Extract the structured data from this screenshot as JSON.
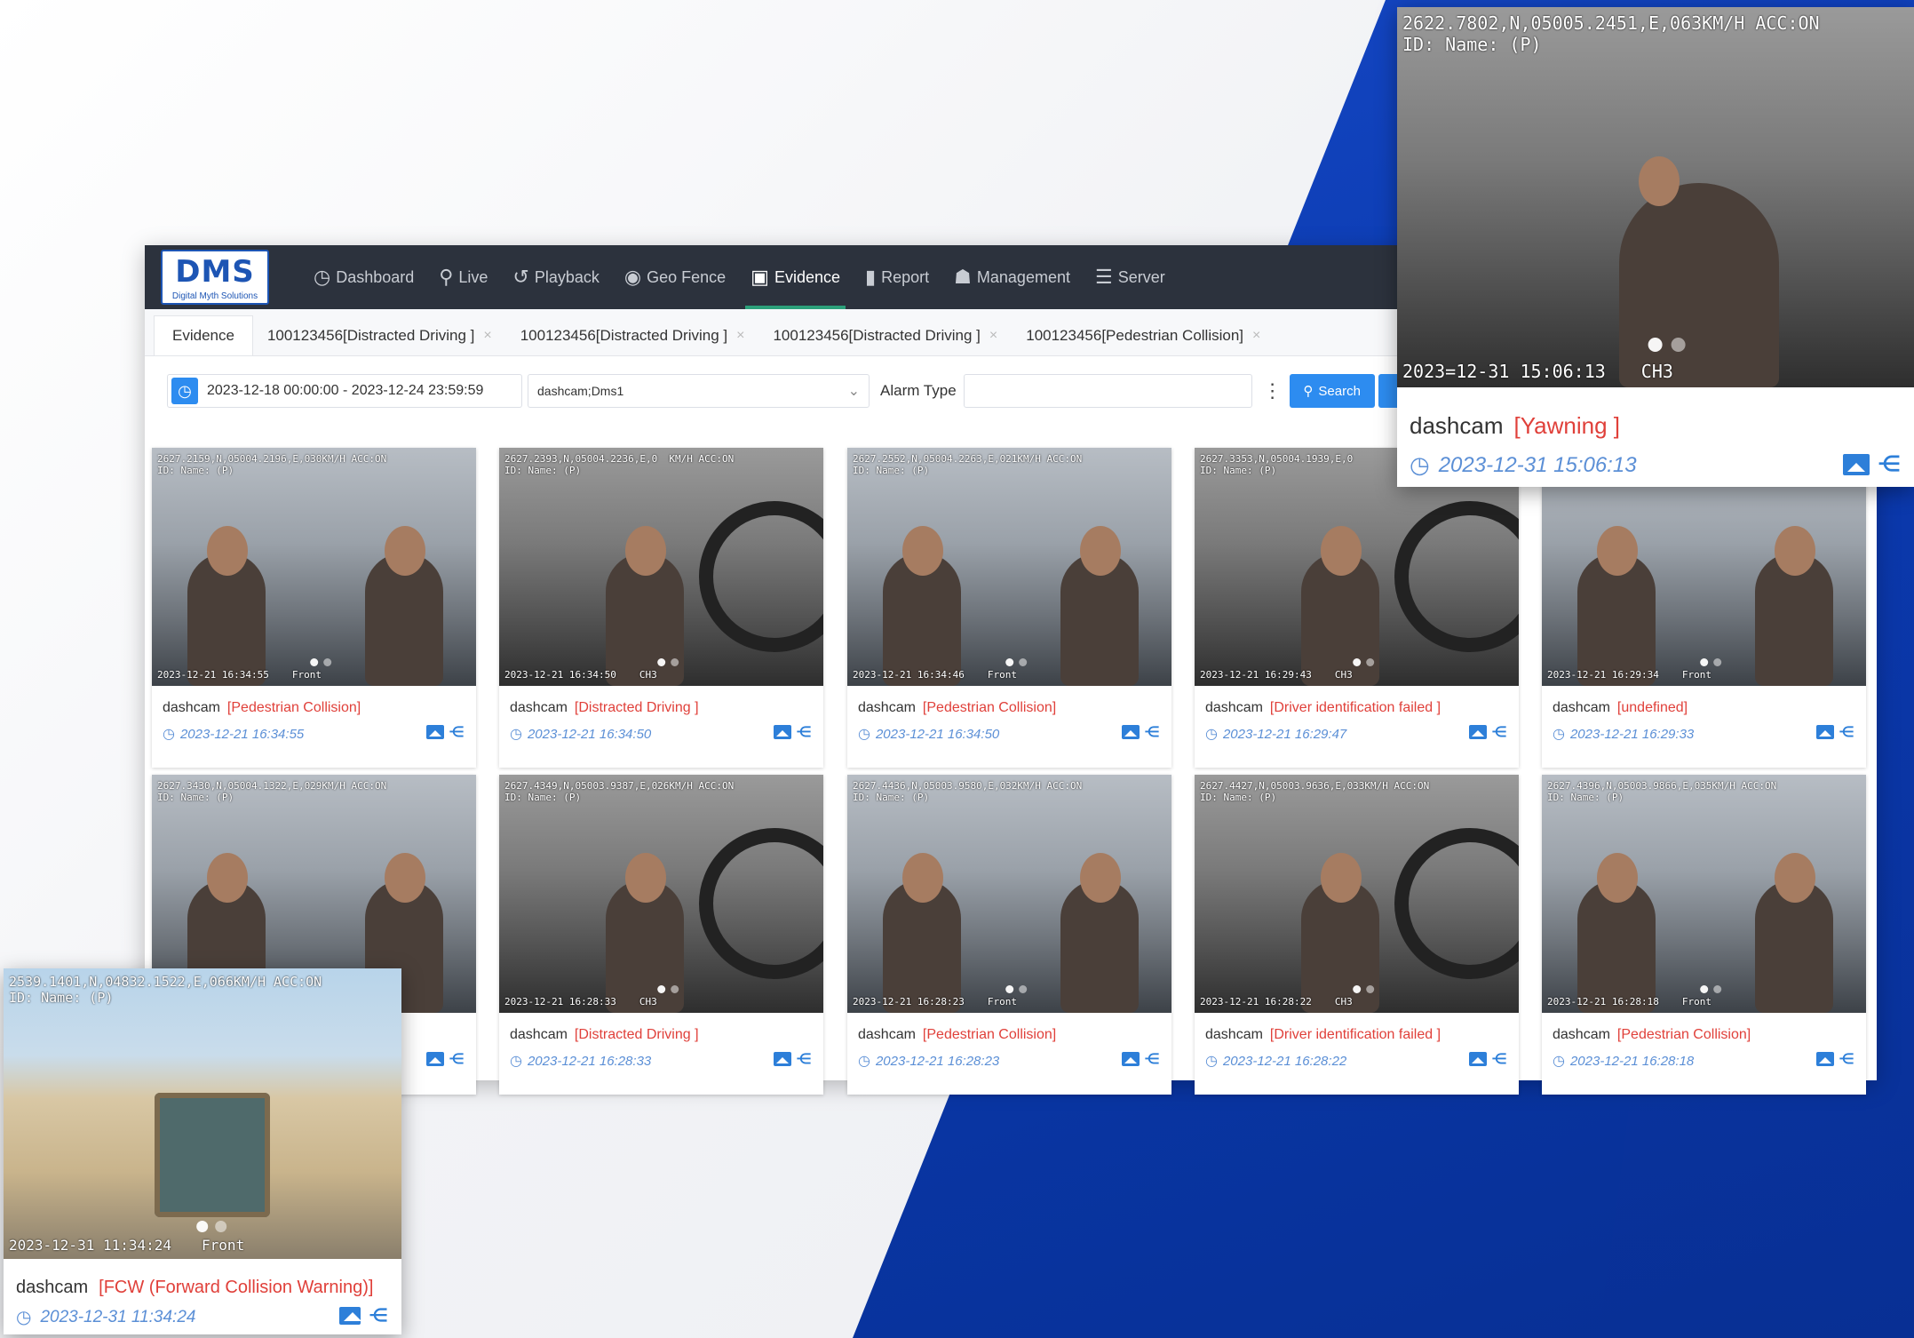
{
  "nav": {
    "logo_text": "DMS",
    "logo_sub": "Digital Myth Solutions",
    "items": [
      {
        "label": "Dashboard",
        "icon": "dashboard-icon",
        "glyph": "◷"
      },
      {
        "label": "Live",
        "icon": "live-icon",
        "glyph": "⚲"
      },
      {
        "label": "Playback",
        "icon": "playback-icon",
        "glyph": "↺"
      },
      {
        "label": "Geo Fence",
        "icon": "geofence-icon",
        "glyph": "◉"
      },
      {
        "label": "Evidence",
        "icon": "evidence-icon",
        "glyph": "▣"
      },
      {
        "label": "Report",
        "icon": "report-icon",
        "glyph": "▮"
      },
      {
        "label": "Management",
        "icon": "management-icon",
        "glyph": "☗"
      },
      {
        "label": "Server",
        "icon": "server-icon",
        "glyph": "☰"
      }
    ],
    "active": "Evidence"
  },
  "tabs": [
    {
      "label": "Evidence",
      "closable": false
    },
    {
      "label": "100123456[Distracted Driving ]",
      "closable": true
    },
    {
      "label": "100123456[Distracted Driving ]",
      "closable": true
    },
    {
      "label": "100123456[Distracted Driving ]",
      "closable": true
    },
    {
      "label": "100123456[Pedestrian Collision]",
      "closable": true
    }
  ],
  "filters": {
    "date_range": "2023-12-18 00:00:00 - 2023-12-24 23:59:59",
    "device": "dashcam;Dms1",
    "alarm_type_label": "Alarm Type",
    "alarm_type_value": "",
    "search_label": "Search"
  },
  "cards": [
    {
      "device": "dashcam",
      "alarm": "[Pedestrian Collision]",
      "time": "2023-12-21 16:34:55",
      "osd": "2627.2159,N,05004.2196,E,030KM/H ACC:ON\nID: Name: (P)",
      "osd_time": "2023-12-21 16:34:55",
      "channel": "Front",
      "mode": "color"
    },
    {
      "device": "dashcam",
      "alarm": "[Distracted Driving ]",
      "time": "2023-12-21 16:34:50",
      "osd": "2627.2393,N,05004.2236,E,0  KM/H ACC:ON\nID: Name: (P)",
      "osd_time": "2023-12-21 16:34:50",
      "channel": "CH3",
      "mode": "night"
    },
    {
      "device": "dashcam",
      "alarm": "[Pedestrian Collision]",
      "time": "2023-12-21 16:34:50",
      "osd": "2627.2552,N,05004.2263,E,021KM/H ACC:ON\nID: Name: (P)",
      "osd_time": "2023-12-21 16:34:46",
      "channel": "Front",
      "mode": "color"
    },
    {
      "device": "dashcam",
      "alarm": "[Driver identification failed ]",
      "time": "2023-12-21 16:29:47",
      "osd": "2627.3353,N,05004.1939,E,0\nID: Name: (P)",
      "osd_time": "2023-12-21 16:29:43",
      "channel": "CH3",
      "mode": "night"
    },
    {
      "device": "dashcam",
      "alarm": "[undefined]",
      "time": "2023-12-21 16:29:33",
      "osd": "",
      "osd_time": "2023-12-21 16:29:34",
      "channel": "Front",
      "mode": "color"
    },
    {
      "device": "dashcam",
      "alarm": "",
      "time": "",
      "osd": "2627.3430,N,05004.1322,E,029KM/H ACC:ON\nID: Name: (P)",
      "osd_time": "",
      "channel": "",
      "mode": "color"
    },
    {
      "device": "dashcam",
      "alarm": "[Distracted Driving ]",
      "time": "2023-12-21 16:28:33",
      "osd": "2627.4349,N,05003.9387,E,026KM/H ACC:ON\nID: Name: (P)",
      "osd_time": "2023-12-21 16:28:33",
      "channel": "CH3",
      "mode": "night"
    },
    {
      "device": "dashcam",
      "alarm": "[Pedestrian Collision]",
      "time": "2023-12-21 16:28:23",
      "osd": "2627.4436,N,05003.9580,E,032KM/H ACC:ON\nID: Name: (P)",
      "osd_time": "2023-12-21 16:28:23",
      "channel": "Front",
      "mode": "color"
    },
    {
      "device": "dashcam",
      "alarm": "[Driver identification failed ]",
      "time": "2023-12-21 16:28:22",
      "osd": "2627.4427,N,05003.9636,E,033KM/H ACC:ON\nID: Name: (P)",
      "osd_time": "2023-12-21 16:28:22",
      "channel": "CH3",
      "mode": "night"
    },
    {
      "device": "dashcam",
      "alarm": "[Pedestrian Collision]",
      "time": "2023-12-21 16:28:18",
      "osd": "2627.4396,N,05003.9866,E,035KM/H ACC:ON\nID: Name: (P)",
      "osd_time": "2023-12-21 16:28:18",
      "channel": "Front",
      "mode": "color"
    }
  ],
  "popup_yawning": {
    "osd": "2622.7802,N,05005.2451,E,063KM/H ACC:ON\nID: Name: (P)",
    "osd_time": "2023=12-31 15:06:13",
    "channel": "CH3",
    "device": "dashcam",
    "alarm": "[Yawning ]",
    "time": "2023-12-31 15:06:13"
  },
  "popup_fcw": {
    "osd": "2539.1401,N,04832.1522,E,066KM/H ACC:ON\nID: Name: (P)",
    "osd_time": "2023-12-31 11:34:24",
    "channel": "Front",
    "device": "dashcam",
    "alarm": "[FCW (Forward Collision Warning)]",
    "time": "2023-12-31 11:34:24"
  },
  "colors": {
    "accent": "#2d8cf0",
    "alarm": "#e0403a",
    "time": "#5b8fd6",
    "nav_bg": "#2c323d",
    "brand_blue": "#0b3bb1"
  }
}
